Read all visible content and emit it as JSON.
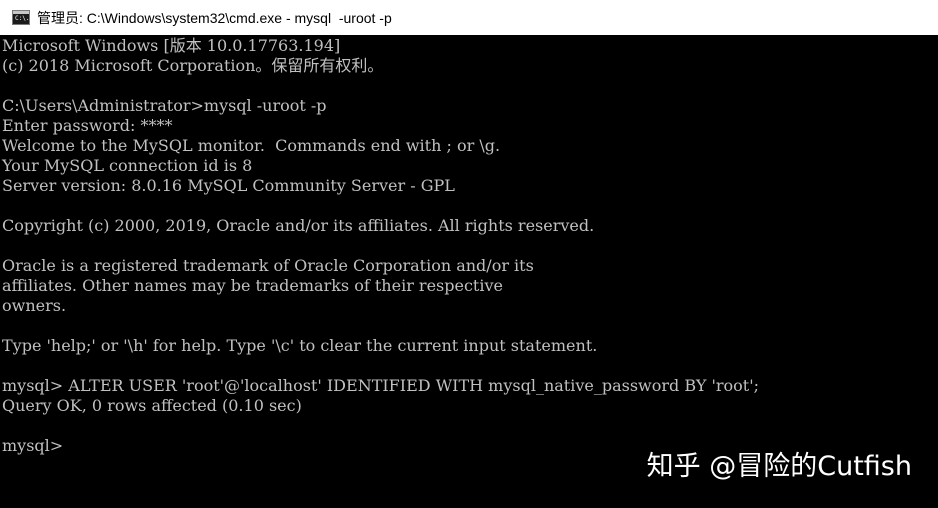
{
  "window": {
    "title": "管理员: C:\\Windows\\system32\\cmd.exe - mysql  -uroot -p",
    "icon": "cmd-console-icon",
    "icon_text": "C:\\."
  },
  "console": {
    "lines": [
      "Microsoft Windows [版本 10.0.17763.194]",
      "(c) 2018 Microsoft Corporation。保留所有权利。",
      "",
      "C:\\Users\\Administrator>mysql -uroot -p",
      "Enter password: ****",
      "Welcome to the MySQL monitor.  Commands end with ; or \\g.",
      "Your MySQL connection id is 8",
      "Server version: 8.0.16 MySQL Community Server - GPL",
      "",
      "Copyright (c) 2000, 2019, Oracle and/or its affiliates. All rights reserved.",
      "",
      "Oracle is a registered trademark of Oracle Corporation and/or its",
      "affiliates. Other names may be trademarks of their respective",
      "owners.",
      "",
      "Type 'help;' or '\\h' for help. Type '\\c' to clear the current input statement.",
      "",
      "mysql> ALTER USER 'root'@'localhost' IDENTIFIED WITH mysql_native_password BY 'root';",
      "Query OK, 0 rows affected (0.10 sec)",
      "",
      "mysql>"
    ],
    "text_color": "#c0c0c0",
    "background_color": "#000000"
  },
  "watermark": {
    "text": "知乎 @冒险的Cutfish"
  }
}
